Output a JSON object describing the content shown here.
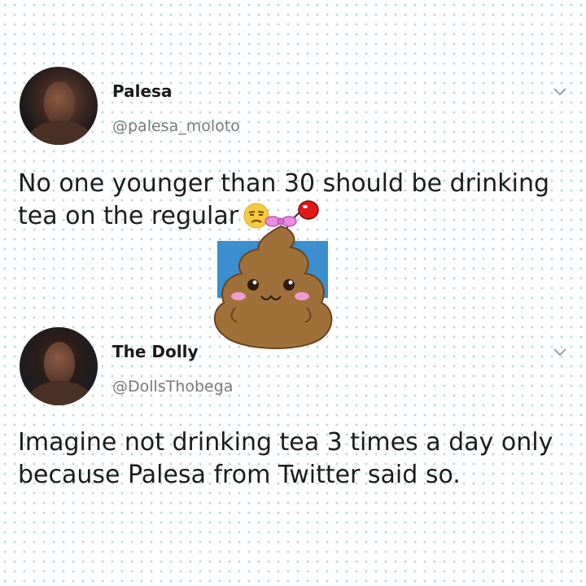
{
  "tweets": [
    {
      "name": "Palesa",
      "handle": "@palesa_moloto",
      "text": "No one younger than 30 should be drinking tea on the regular",
      "emoji": "unamused-face-emoji"
    },
    {
      "name": "The Dolly",
      "handle": "@DollsThobega",
      "text": "Imagine not drinking tea 3 times a day only because Palesa from Twitter said so."
    }
  ],
  "icons": {
    "chevron": "chevron-down-icon",
    "sticker": "poop-sticker-icon"
  },
  "colors": {
    "dots": "#b9dcd6",
    "handle": "#7a7a7a",
    "text": "#1c1c1c",
    "sticker_brown": "#a0703a",
    "sticker_blue": "#3b8fcf",
    "bow_pink": "#e98be0",
    "cherry_red": "#e01818"
  }
}
